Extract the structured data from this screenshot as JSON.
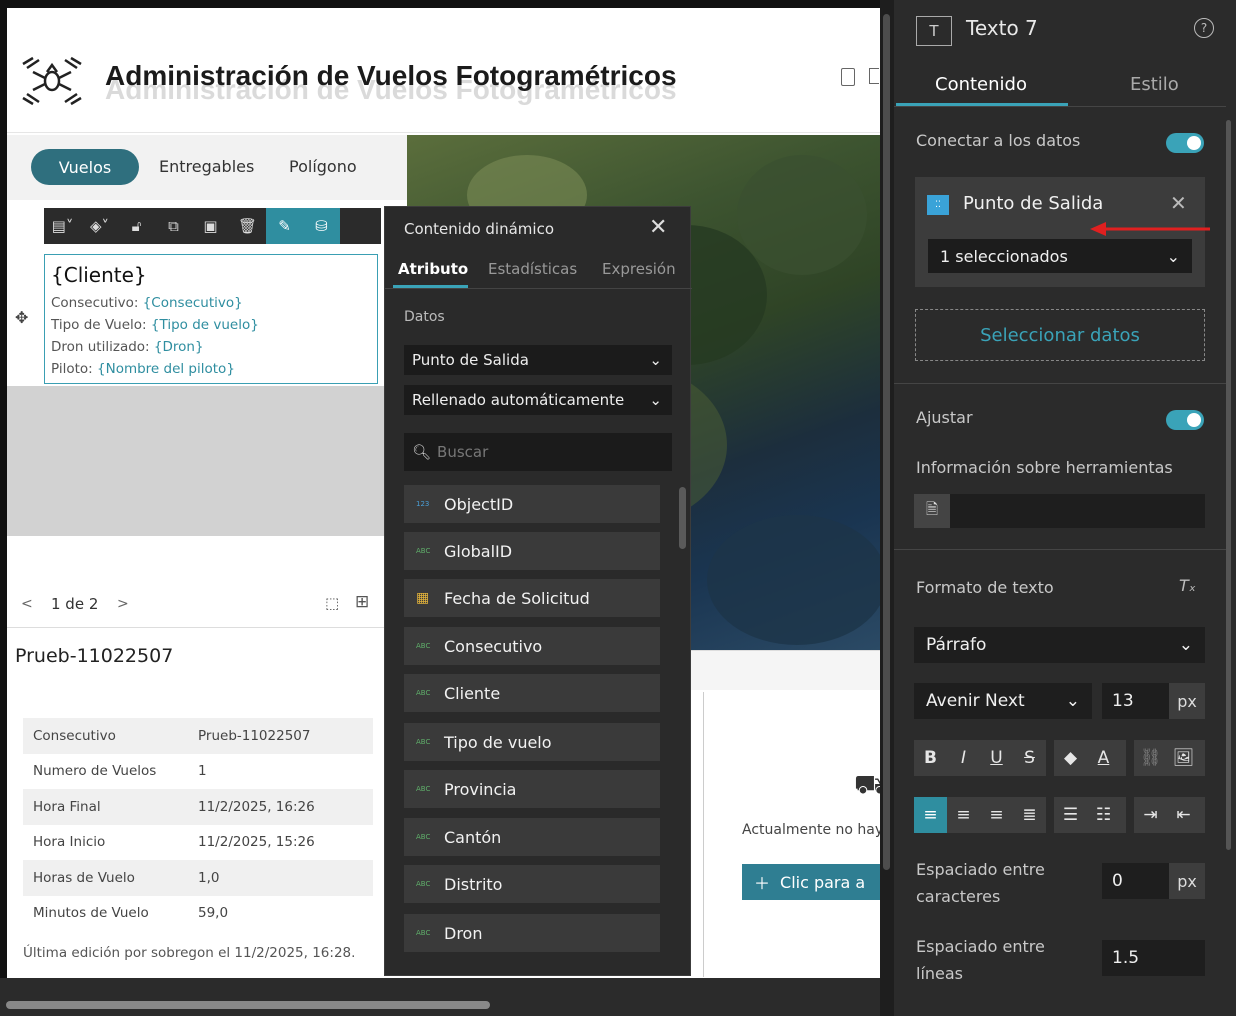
{
  "app": {
    "title": "Administración de Vuelos Fotogramétricos"
  },
  "nav": {
    "items": [
      "Vuelos",
      "Entregables",
      "Polígono"
    ],
    "active": "Vuelos"
  },
  "text_widget": {
    "title": "{Cliente}",
    "lines": [
      {
        "label": "Consecutivo: ",
        "field": "{Consecutivo}"
      },
      {
        "label": "Tipo de Vuelo: ",
        "field": "{Tipo de vuelo}"
      },
      {
        "label": "Dron utilizado: ",
        "field": "{Dron}"
      },
      {
        "label": "Piloto: ",
        "field": "{Nombre del piloto}"
      }
    ]
  },
  "pager": {
    "prev": "<",
    "text": "1 de 2",
    "next": ">"
  },
  "record": {
    "id": "Prueb-11022507",
    "attributes": [
      {
        "key": "Consecutivo",
        "value": "Prueb-11022507"
      },
      {
        "key": "Numero de Vuelos",
        "value": "1"
      },
      {
        "key": "Hora Final",
        "value": "11/2/2025, 16:26"
      },
      {
        "key": "Hora Inicio",
        "value": "11/2/2025, 15:26"
      },
      {
        "key": "Horas de Vuelo",
        "value": "1,0"
      },
      {
        "key": "Minutos de Vuelo",
        "value": "59,0"
      }
    ],
    "last_edit": "Última edición por sobregon el 11/2/2025, 16:28."
  },
  "empty_card": {
    "message": "Actualmente no hay",
    "button": "Clic para a"
  },
  "dynamic_panel": {
    "title": "Contenido dinámico",
    "tabs": [
      "Atributo",
      "Estadísticas",
      "Expresión"
    ],
    "active_tab": "Atributo",
    "data_label": "Datos",
    "data_source": "Punto de Salida",
    "fill_mode": "Rellenado automáticamente",
    "search_placeholder": "Buscar",
    "fields": [
      {
        "name": "ObjectID",
        "type": "123"
      },
      {
        "name": "GlobalID",
        "type": "ABC"
      },
      {
        "name": "Fecha de Solicitud",
        "type": "date"
      },
      {
        "name": "Consecutivo",
        "type": "ABC"
      },
      {
        "name": "Cliente",
        "type": "ABC"
      },
      {
        "name": "Tipo de vuelo",
        "type": "ABC"
      },
      {
        "name": "Provincia",
        "type": "ABC"
      },
      {
        "name": "Cantón",
        "type": "ABC"
      },
      {
        "name": "Distrito",
        "type": "ABC"
      },
      {
        "name": "Dron",
        "type": "ABC"
      }
    ]
  },
  "settings": {
    "widget_title": "Texto 7",
    "tabs": [
      "Contenido",
      "Estilo"
    ],
    "active_tab": "Contenido",
    "connect_label": "Conectar a los datos",
    "connect_on": true,
    "datasource_name": "Punto de Salida",
    "datasource_selection": "1 seleccionados",
    "select_data": "Seleccionar datos",
    "wrap_label": "Ajustar",
    "wrap_on": true,
    "tooltip_label": "Información sobre herramientas",
    "format_label": "Formato de texto",
    "paragraph": "Párrafo",
    "font": "Avenir Next",
    "font_size": "13",
    "font_unit": "px",
    "letter_spacing_label": "Espaciado entre caracteres",
    "letter_spacing": "0",
    "letter_spacing_unit": "px",
    "line_spacing_label": "Espaciado entre líneas",
    "line_spacing": "1.5"
  },
  "colors": {
    "accent": "#3aa3b8",
    "pill": "#2f6f7e",
    "panel_bg": "#2b2b2b",
    "annotation_arrow": "#e02020"
  }
}
